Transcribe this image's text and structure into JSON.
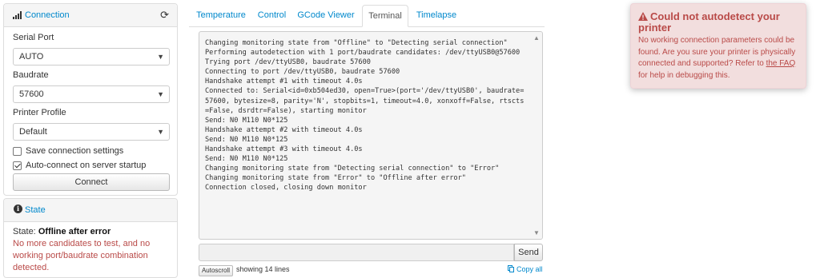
{
  "connection": {
    "title": "Connection",
    "serial_port_label": "Serial Port",
    "serial_port_value": "AUTO",
    "baudrate_label": "Baudrate",
    "baudrate_value": "57600",
    "profile_label": "Printer Profile",
    "profile_value": "Default",
    "save_settings_label": "Save connection settings",
    "save_settings_checked": false,
    "autoconnect_label": "Auto-connect on server startup",
    "autoconnect_checked": true,
    "connect_button": "Connect"
  },
  "state": {
    "title": "State",
    "label": "State:",
    "value": "Offline after error",
    "error": "No more candidates to test, and no working port/baudrate combination detected."
  },
  "tabs": [
    {
      "label": "Temperature"
    },
    {
      "label": "Control"
    },
    {
      "label": "GCode Viewer"
    },
    {
      "label": "Terminal",
      "active": true
    },
    {
      "label": "Timelapse"
    }
  ],
  "terminal": {
    "lines": [
      "Changing monitoring state from \"Offline\" to \"Detecting serial connection\"",
      "Performing autodetection with 1 port/baudrate candidates: /dev/ttyUSB0@57600",
      "Trying port /dev/ttyUSB0, baudrate 57600",
      "Connecting to port /dev/ttyUSB0, baudrate 57600",
      "Handshake attempt #1 with timeout 4.0s",
      "Connected to: Serial<id=0xb504ed30, open=True>(port='/dev/ttyUSB0', baudrate=",
      "57600, bytesize=8, parity='N', stopbits=1, timeout=4.0, xonxoff=False, rtscts",
      "=False, dsrdtr=False), starting monitor",
      "Send: N0 M110 N0*125",
      "Handshake attempt #2 with timeout 4.0s",
      "Send: N0 M110 N0*125",
      "Handshake attempt #3 with timeout 4.0s",
      "Send: N0 M110 N0*125",
      "Changing monitoring state from \"Detecting serial connection\" to \"Error\"",
      "Changing monitoring state from \"Error\" to \"Offline after error\"",
      "Connection closed, closing down monitor"
    ],
    "send_button": "Send",
    "autoscroll_button": "Autoscroll",
    "showing_text": "showing 14 lines",
    "copy_all": "Copy all"
  },
  "alert": {
    "title": "Could not autodetect your printer",
    "body_before": "No working connection parameters could be found. Are you sure your printer is physically connected and supported? Refer to ",
    "link_text": "the FAQ",
    "body_after": " for help in debugging this."
  },
  "colors": {
    "link": "#0088cc",
    "error_text": "#b94a48",
    "alert_background": "#f2dede"
  },
  "icons": {
    "connection": "signal-bars-icon",
    "refresh": "refresh-icon",
    "state": "info-circle-icon",
    "alert": "warning-triangle-icon",
    "copy": "copy-icon"
  }
}
